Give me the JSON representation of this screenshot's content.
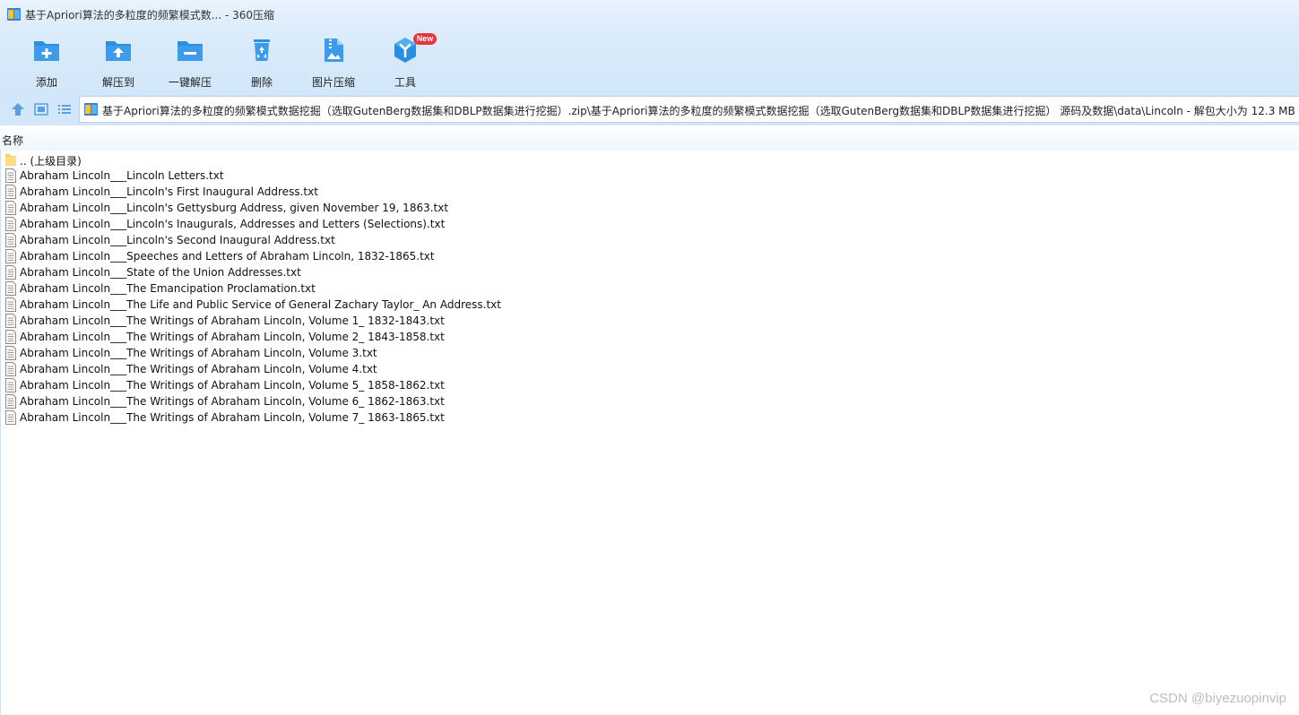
{
  "window": {
    "title": "基于Apriori算法的多粒度的频繁模式数... - 360压缩"
  },
  "toolbar": {
    "items": [
      {
        "label": "添加",
        "icon": "add-folder-icon"
      },
      {
        "label": "解压到",
        "icon": "extract-to-icon"
      },
      {
        "label": "一键解压",
        "icon": "one-click-extract-icon"
      },
      {
        "label": "删除",
        "icon": "recycle-bin-icon"
      },
      {
        "label": "图片压缩",
        "icon": "image-compress-icon"
      },
      {
        "label": "工具",
        "icon": "tools-icon",
        "badge": "New"
      }
    ]
  },
  "navbar": {
    "address": "基于Apriori算法的多粒度的频繁模式数据挖掘（选取GutenBerg数据集和DBLP数据集进行挖掘）.zip\\基于Apriori算法的多粒度的频繁模式数据挖掘（选取GutenBerg数据集和DBLP数据集进行挖掘） 源码及数据\\data\\Lincoln - 解包大小为 12.3 MB"
  },
  "list": {
    "column_name": "名称",
    "parent": ".. (上级目录)",
    "files": [
      "Abraham Lincoln___Lincoln Letters.txt",
      "Abraham Lincoln___Lincoln's First Inaugural Address.txt",
      "Abraham Lincoln___Lincoln's Gettysburg Address, given November 19, 1863.txt",
      "Abraham Lincoln___Lincoln's Inaugurals, Addresses and Letters (Selections).txt",
      "Abraham Lincoln___Lincoln's Second Inaugural Address.txt",
      "Abraham Lincoln___Speeches and Letters of Abraham Lincoln, 1832-1865.txt",
      "Abraham Lincoln___State of the Union Addresses.txt",
      "Abraham Lincoln___The Emancipation Proclamation.txt",
      "Abraham Lincoln___The Life and Public Service of General Zachary Taylor_ An Address.txt",
      "Abraham Lincoln___The Writings of Abraham Lincoln, Volume 1_ 1832-1843.txt",
      "Abraham Lincoln___The Writings of Abraham Lincoln, Volume 2_ 1843-1858.txt",
      "Abraham Lincoln___The Writings of Abraham Lincoln, Volume 3.txt",
      "Abraham Lincoln___The Writings of Abraham Lincoln, Volume 4.txt",
      "Abraham Lincoln___The Writings of Abraham Lincoln, Volume 5_ 1858-1862.txt",
      "Abraham Lincoln___The Writings of Abraham Lincoln, Volume 6_ 1862-1863.txt",
      "Abraham Lincoln___The Writings of Abraham Lincoln, Volume 7_ 1863-1865.txt"
    ]
  },
  "watermark": "CSDN @biyezuopinvip",
  "colors": {
    "accent": "#2a8fe0",
    "badge": "#e8343a"
  }
}
